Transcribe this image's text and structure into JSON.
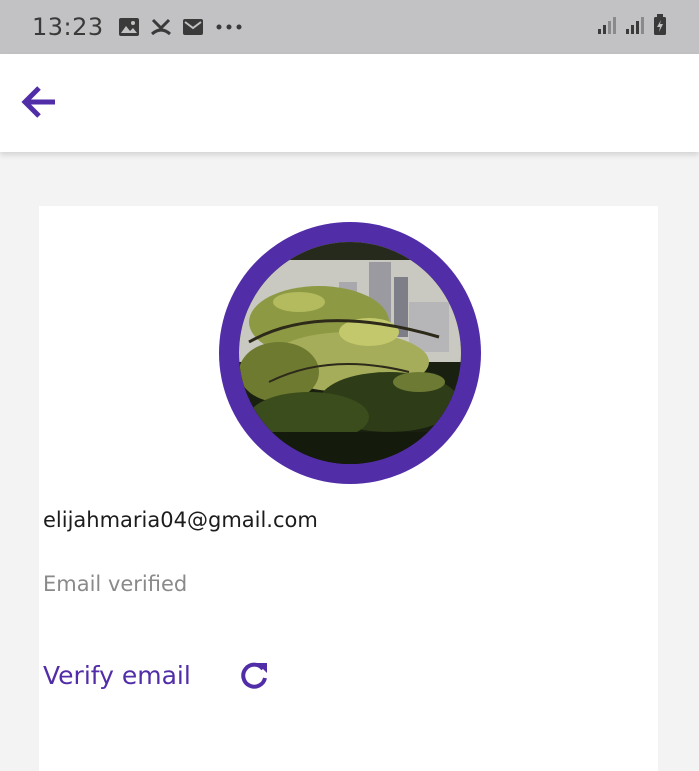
{
  "status_bar": {
    "time": "13:23",
    "icons": [
      "image-icon",
      "missed-call-icon",
      "mail-icon",
      "more-dots-icon"
    ],
    "right_icons": [
      "signal-icon",
      "signal-icon",
      "battery-charging-icon"
    ]
  },
  "app_bar": {
    "back_icon": "arrow-back-icon"
  },
  "profile": {
    "email": "elijahmaria04@gmail.com",
    "verified_status": "Email verified",
    "verify_label": "Verify email",
    "refresh_icon": "refresh-icon"
  },
  "colors": {
    "accent": "#512da8",
    "status_bar": "#c2c2c4",
    "background": "#f3f3f3",
    "card": "#ffffff",
    "muted_text": "#8a8a8a"
  }
}
